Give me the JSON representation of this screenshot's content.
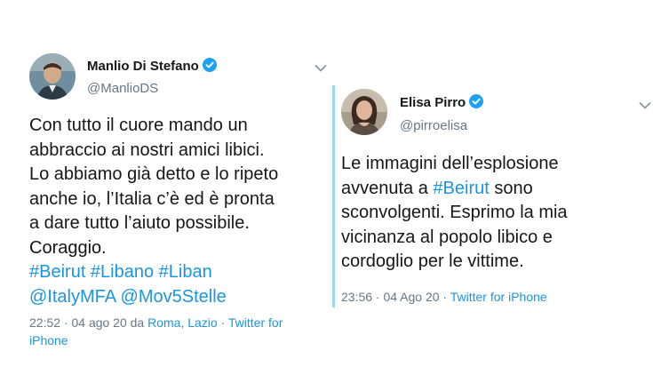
{
  "tweets": [
    {
      "name": "Manlio Di Stefano",
      "handle": "@ManlioDS",
      "body": [
        {
          "text": "Con tutto il cuore mando un"
        },
        {
          "text": "abbraccio ai nostri amici libici."
        },
        {
          "text": "Lo abbiamo già detto e lo ripeto"
        },
        {
          "text": "anche io, l’Italia c’è ed è pronta"
        },
        {
          "text": "a dare tutto l’aiuto possibile."
        },
        {
          "text": "Coraggio."
        },
        {
          "text": "#Beirut #Libano #Liban",
          "link": true
        },
        {
          "text": "@ItalyMFA @Mov5Stelle",
          "link": true
        }
      ],
      "meta": {
        "time": "22:52 · 04 ago 20 da ",
        "location": "Roma, Lazio",
        "sep": " · ",
        "source": "Twitter for",
        "source2": "iPhone"
      }
    },
    {
      "name": "Elisa Pirro",
      "handle": "@pirroelisa",
      "body": [
        {
          "text": "Le immagini dell’esplosione"
        },
        {
          "prefix": "avvenuta a ",
          "tag": "#Beirut",
          "suffix": " sono"
        },
        {
          "text": "sconvolgenti. Esprimo la mia"
        },
        {
          "text": "vicinanza al popolo libico e"
        },
        {
          "text": "cordoglio per le vittime."
        }
      ],
      "meta": {
        "time": "23:56 · 04 Ago 20 · ",
        "source": "Twitter for iPhone"
      }
    }
  ],
  "icons": {
    "verified": "verified-badge-icon",
    "chevron": "chevron-down-icon"
  },
  "colors": {
    "accent": "#1b95e0",
    "verified": "#1da1f2",
    "text": "#14171a",
    "muted": "#657786",
    "bar": "#9fd3f7"
  }
}
